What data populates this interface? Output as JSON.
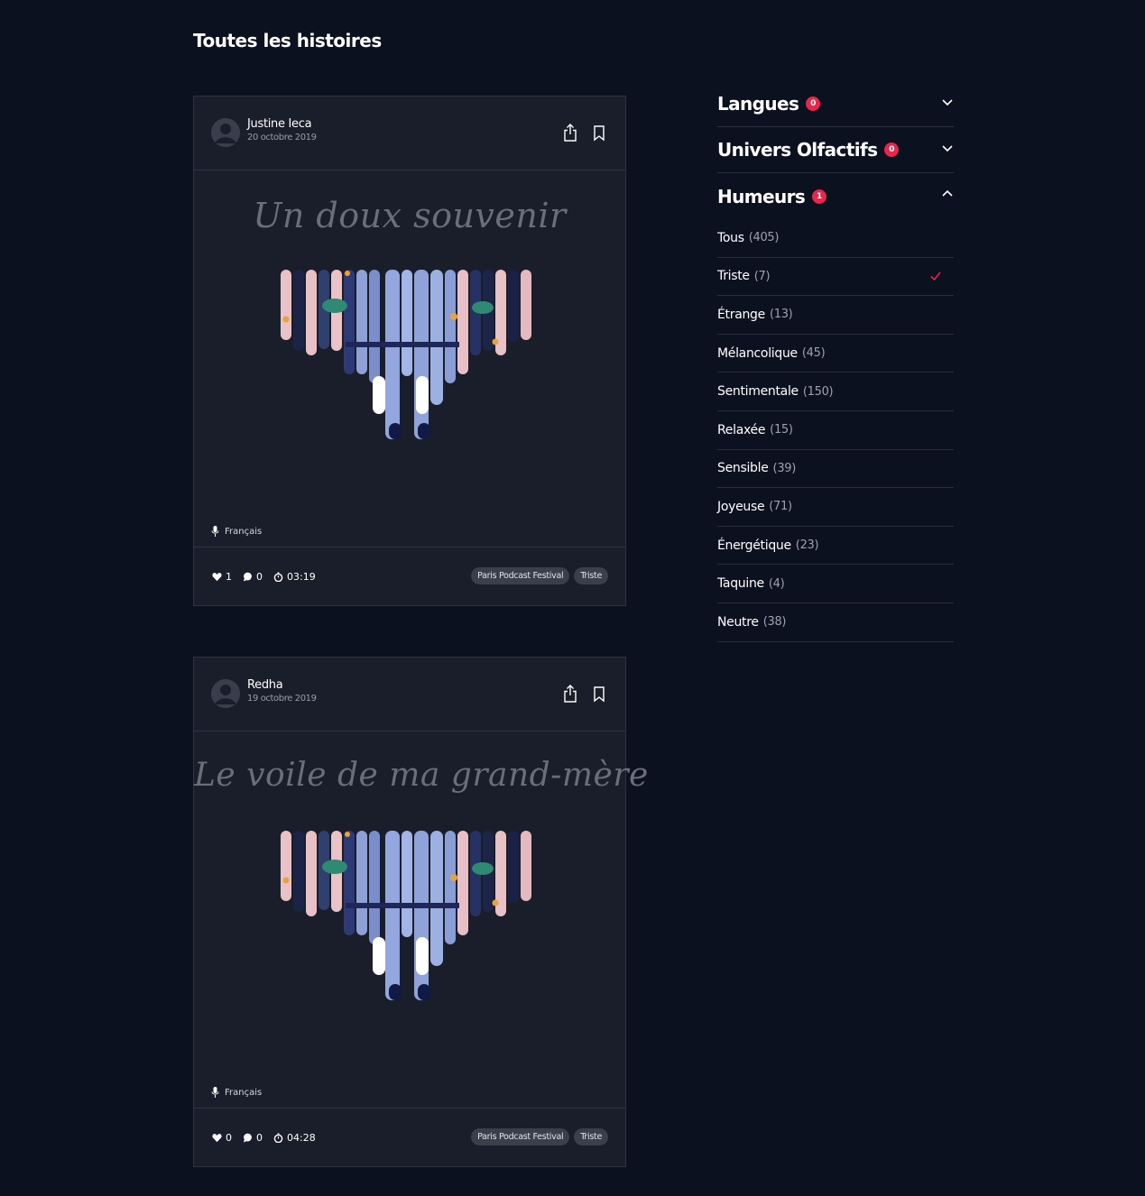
{
  "page": {
    "title": "Toutes les histoires"
  },
  "stories": [
    {
      "author": "Justine Ieca",
      "date": "20 octobre 2019",
      "title": "Un doux souvenir",
      "language": "Français",
      "likes": "1",
      "comments": "0",
      "duration": "03:19",
      "tags": [
        "Paris Podcast Festival",
        "Triste"
      ]
    },
    {
      "author": "Redha",
      "date": "19 octobre 2019",
      "title": "Le voile de ma grand-mère",
      "language": "Français",
      "likes": "0",
      "comments": "0",
      "duration": "04:28",
      "tags": [
        "Paris Podcast Festival",
        "Triste"
      ]
    }
  ],
  "filters": {
    "langues": {
      "title": "Langues",
      "badge": "0",
      "expanded": false
    },
    "univers": {
      "title": "Univers Olfactifs",
      "badge": "0",
      "expanded": false
    },
    "humeurs": {
      "title": "Humeurs",
      "badge": "1",
      "expanded": true,
      "items": [
        {
          "label": "Tous",
          "count": "(405)",
          "checked": false
        },
        {
          "label": "Triste",
          "count": "(7)",
          "checked": true
        },
        {
          "label": "Étrange",
          "count": "(13)",
          "checked": false
        },
        {
          "label": "Mélancolique",
          "count": "(45)",
          "checked": false
        },
        {
          "label": "Sentimentale",
          "count": "(150)",
          "checked": false
        },
        {
          "label": "Relaxée",
          "count": "(15)",
          "checked": false
        },
        {
          "label": "Sensible",
          "count": "(39)",
          "checked": false
        },
        {
          "label": "Joyeuse",
          "count": "(71)",
          "checked": false
        },
        {
          "label": "Énergétique",
          "count": "(23)",
          "checked": false
        },
        {
          "label": "Taquine",
          "count": "(4)",
          "checked": false
        },
        {
          "label": "Neutre",
          "count": "(38)",
          "checked": false
        }
      ]
    }
  },
  "colors": {
    "background": "#0c1120",
    "card": "#1a1d2a",
    "accent": "#e8254a",
    "tag_bg": "#3b3e4b"
  },
  "icons": [
    "avatar-icon",
    "share-icon",
    "bookmark-icon",
    "microphone-icon",
    "heart-icon",
    "comment-icon",
    "timer-icon",
    "chevron-down-icon",
    "chevron-up-icon",
    "check-icon"
  ]
}
